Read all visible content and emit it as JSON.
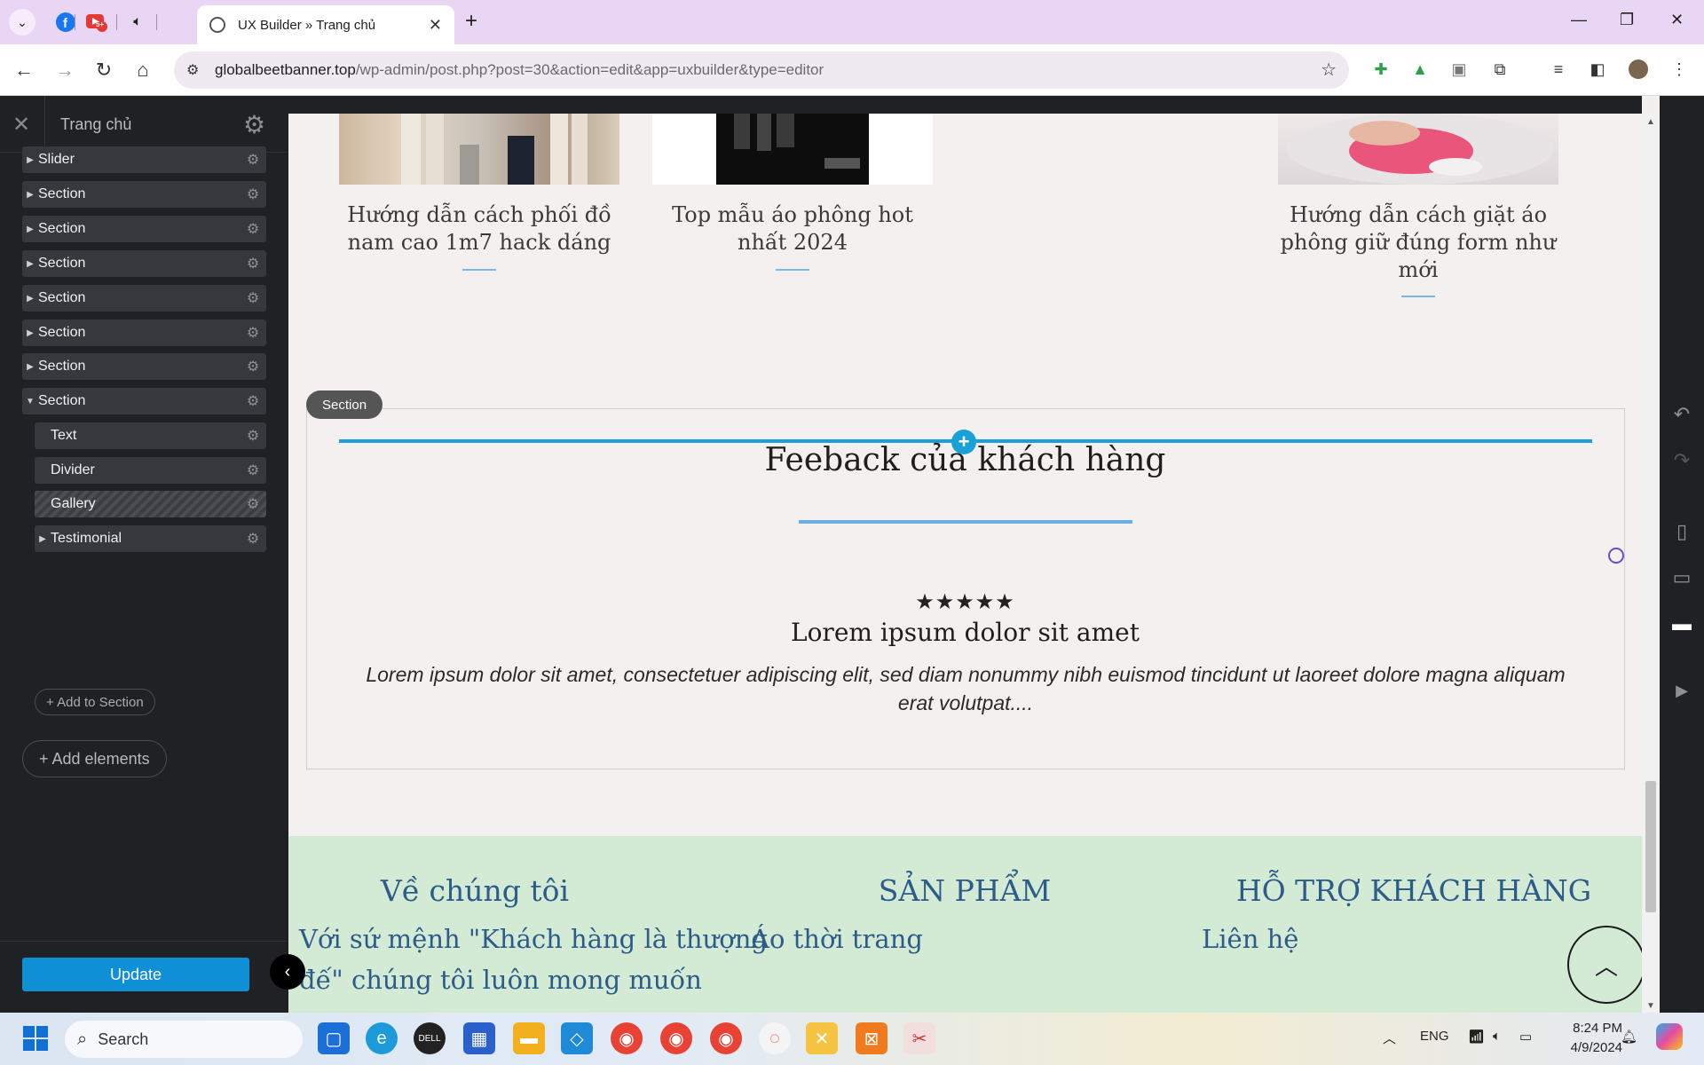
{
  "browser": {
    "active_tab_title": "UX Builder » Trang chủ",
    "url_host": "globalbeetbanner.top",
    "url_path": "/wp-admin/post.php?post=30&action=edit&app=uxbuilder&type=editor",
    "notification_badge": "5+"
  },
  "panel": {
    "title": "Trang chủ",
    "tree": [
      {
        "label": "Slider",
        "expanded": false
      },
      {
        "label": "Section",
        "expanded": false
      },
      {
        "label": "Section",
        "expanded": false
      },
      {
        "label": "Section",
        "expanded": false
      },
      {
        "label": "Section",
        "expanded": false
      },
      {
        "label": "Section",
        "expanded": false
      },
      {
        "label": "Section",
        "expanded": false
      },
      {
        "label": "Section",
        "expanded": true
      }
    ],
    "children": [
      {
        "label": "Text"
      },
      {
        "label": "Divider"
      },
      {
        "label": "Gallery"
      },
      {
        "label": "Testimonial"
      }
    ],
    "add_to_section": "+ Add to Section",
    "add_elements": "+ Add elements",
    "update_button": "Update"
  },
  "canvas": {
    "posts": [
      {
        "title": "Hướng dẫn cách phối đồ nam cao 1m7 hack dáng"
      },
      {
        "title": "Top mẫu áo phông hot nhất 2024"
      },
      {
        "title": "Hướng dẫn cách giặt áo phông giữ đúng form như mới"
      }
    ],
    "section_tag": "Section",
    "feedback_title": "Feeback của khách hàng",
    "stars": "★★★★★",
    "testimonial_name": "Lorem ipsum dolor sit amet",
    "testimonial_text": "Lorem ipsum dolor sit amet, consectetuer adipiscing elit, sed diam nonummy nibh euismod tincidunt ut laoreet dolore magna aliquam erat volutpat....",
    "footer": {
      "col1_title": "Về chúng tôi",
      "col1_text_line1": "Với sứ mệnh \"Khách hàng là thượng",
      "col1_text_line2": "đế\" chúng tôi luôn mong muốn",
      "col2_title": "SẢN PHẨM",
      "col2_item": "Áo thời trang",
      "col3_title": "HỖ TRỢ KHÁCH HÀNG",
      "col3_item": "Liên hệ"
    }
  },
  "taskbar": {
    "search_label": "Search",
    "language": "ENG",
    "time": "8:24 PM",
    "date": "4/9/2024"
  },
  "colors": {
    "accent_blue": "#1aa0d8",
    "update_button": "#0f8fd6",
    "footer_bg": "#d3ead4",
    "footer_text": "#2d5c8a",
    "panel_bg": "#1f2124"
  }
}
